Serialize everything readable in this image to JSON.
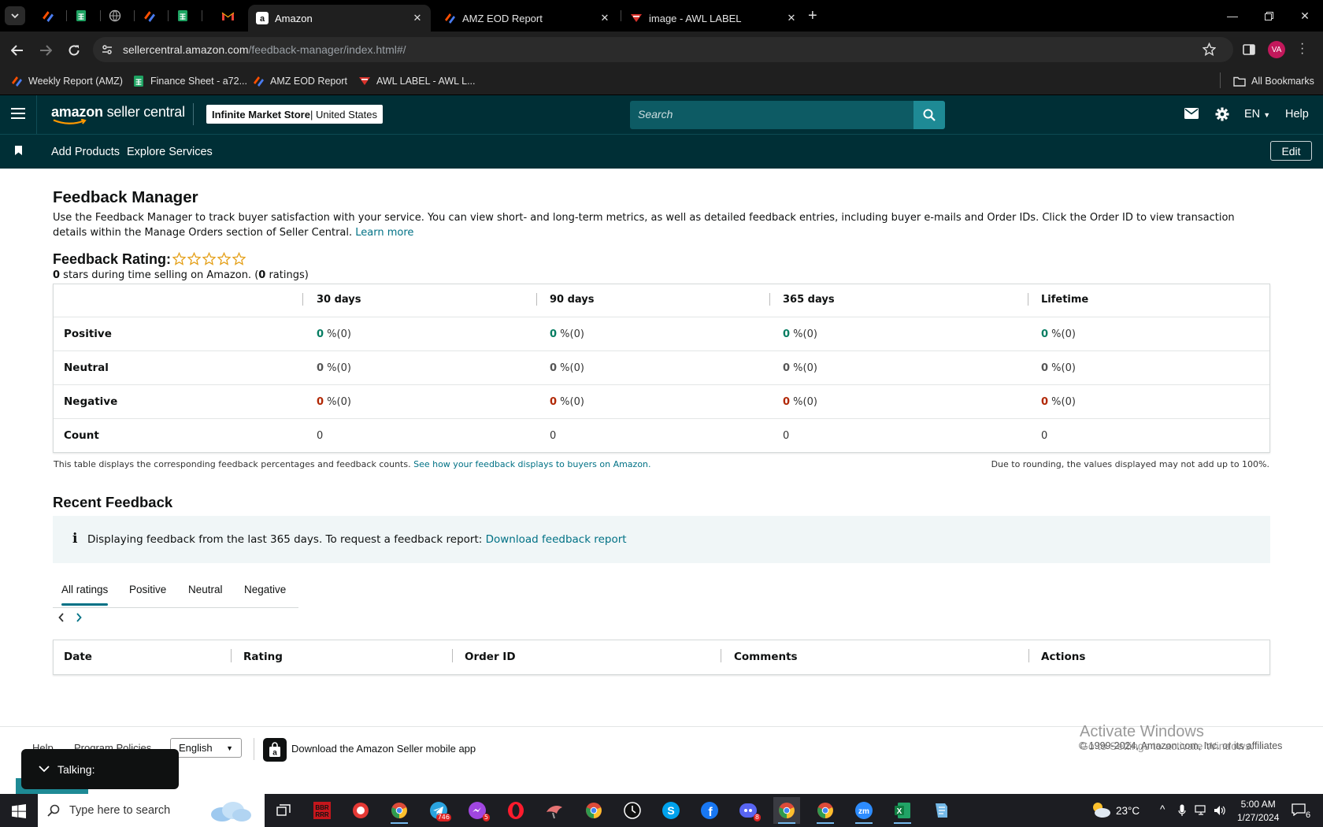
{
  "browser": {
    "tabs": [
      {
        "title": "Amazon",
        "active": true
      },
      {
        "title": "AMZ EOD Report",
        "active": false
      },
      {
        "title": "image - AWL LABEL",
        "active": false
      }
    ],
    "pinned_icons": [
      "zapier-icon",
      "sheets-icon",
      "globe-icon",
      "zapier-icon",
      "sheets-icon",
      "gmail-icon"
    ],
    "url_host": "sellercentral.amazon.com",
    "url_path": "/feedback-manager/index.html#/",
    "profile_initials": "VA",
    "bookmarks": [
      "Weekly Report (AMZ)",
      "Finance Sheet - a72...",
      "AMZ EOD Report",
      "AWL LABEL - AWL L..."
    ],
    "all_bookmarks": "All Bookmarks"
  },
  "header": {
    "logo_bold": "amazon",
    "logo_rest": " seller central",
    "store_name": "Infinite Market Store",
    "store_region": " | United States",
    "search_placeholder": "Search",
    "language": "EN",
    "help": "Help",
    "nav_items": [
      "Add Products",
      "Explore Services"
    ],
    "edit": "Edit"
  },
  "page": {
    "title": "Feedback Manager",
    "description": "Use the Feedback Manager to track buyer satisfaction with your service. You can view short- and long-term metrics, as well as detailed feedback entries, including buyer e-mails and Order IDs. Click the Order ID to view transaction details within the Manage Orders section of Seller Central.",
    "learn_more": "Learn more",
    "rating_label": "Feedback Rating:",
    "stars_filled": 0,
    "stars_total": 5,
    "rating_stars": "0",
    "rating_mid": " stars during time selling on Amazon. (",
    "rating_count": "0",
    "rating_tail": " ratings)"
  },
  "metrics": {
    "columns": [
      "30 days",
      "90 days",
      "365 days",
      "Lifetime"
    ],
    "rows": [
      {
        "label": "Positive",
        "values": [
          "0",
          "0",
          "0",
          "0"
        ],
        "counts": [
          " %(0)",
          " %(0)",
          " %(0)",
          " %(0)"
        ]
      },
      {
        "label": "Neutral",
        "values": [
          "0",
          "0",
          "0",
          "0"
        ],
        "counts": [
          " %(0)",
          " %(0)",
          " %(0)",
          " %(0)"
        ]
      },
      {
        "label": "Negative",
        "values": [
          "0",
          "0",
          "0",
          "0"
        ],
        "counts": [
          " %(0)",
          " %(0)",
          " %(0)",
          " %(0)"
        ]
      },
      {
        "label": "Count",
        "values": [
          "0",
          "0",
          "0",
          "0"
        ],
        "counts": [
          "",
          "",
          "",
          ""
        ]
      }
    ],
    "note": "This table displays the corresponding feedback percentages and feedback counts.",
    "note_link": "See how your feedback displays to buyers on Amazon.",
    "rounding_note": "Due to rounding, the values displayed may not add up to 100%."
  },
  "recent": {
    "title": "Recent Feedback",
    "info_text": "Displaying feedback from the last 365 days. To request a feedback report:",
    "info_link": "Download feedback report",
    "tabs": [
      "All ratings",
      "Positive",
      "Neutral",
      "Negative"
    ],
    "columns": [
      "Date",
      "Rating",
      "Order ID",
      "Comments",
      "Actions"
    ]
  },
  "footer": {
    "links": [
      "Help",
      "Program Policies"
    ],
    "language": "English",
    "app_text": "Download the Amazon Seller mobile app",
    "copyright": "© 1999-2024, Amazon.com, Inc. or its affiliates",
    "activate_title": "Activate Windows",
    "activate_sub": "Go to Settings to activate Windows.",
    "talking": "Talking:"
  },
  "taskbar": {
    "search_placeholder": "Type here to search",
    "telegram_badge": "746",
    "messenger_badge": "5",
    "discord_badge": "8",
    "temperature": "23°C",
    "time": "5:00 AM",
    "date": "1/27/2024",
    "notifications": "6"
  },
  "colors": {
    "seller_header": "#002f36",
    "link": "#007185",
    "positive": "#067d62",
    "negative": "#b12704"
  }
}
